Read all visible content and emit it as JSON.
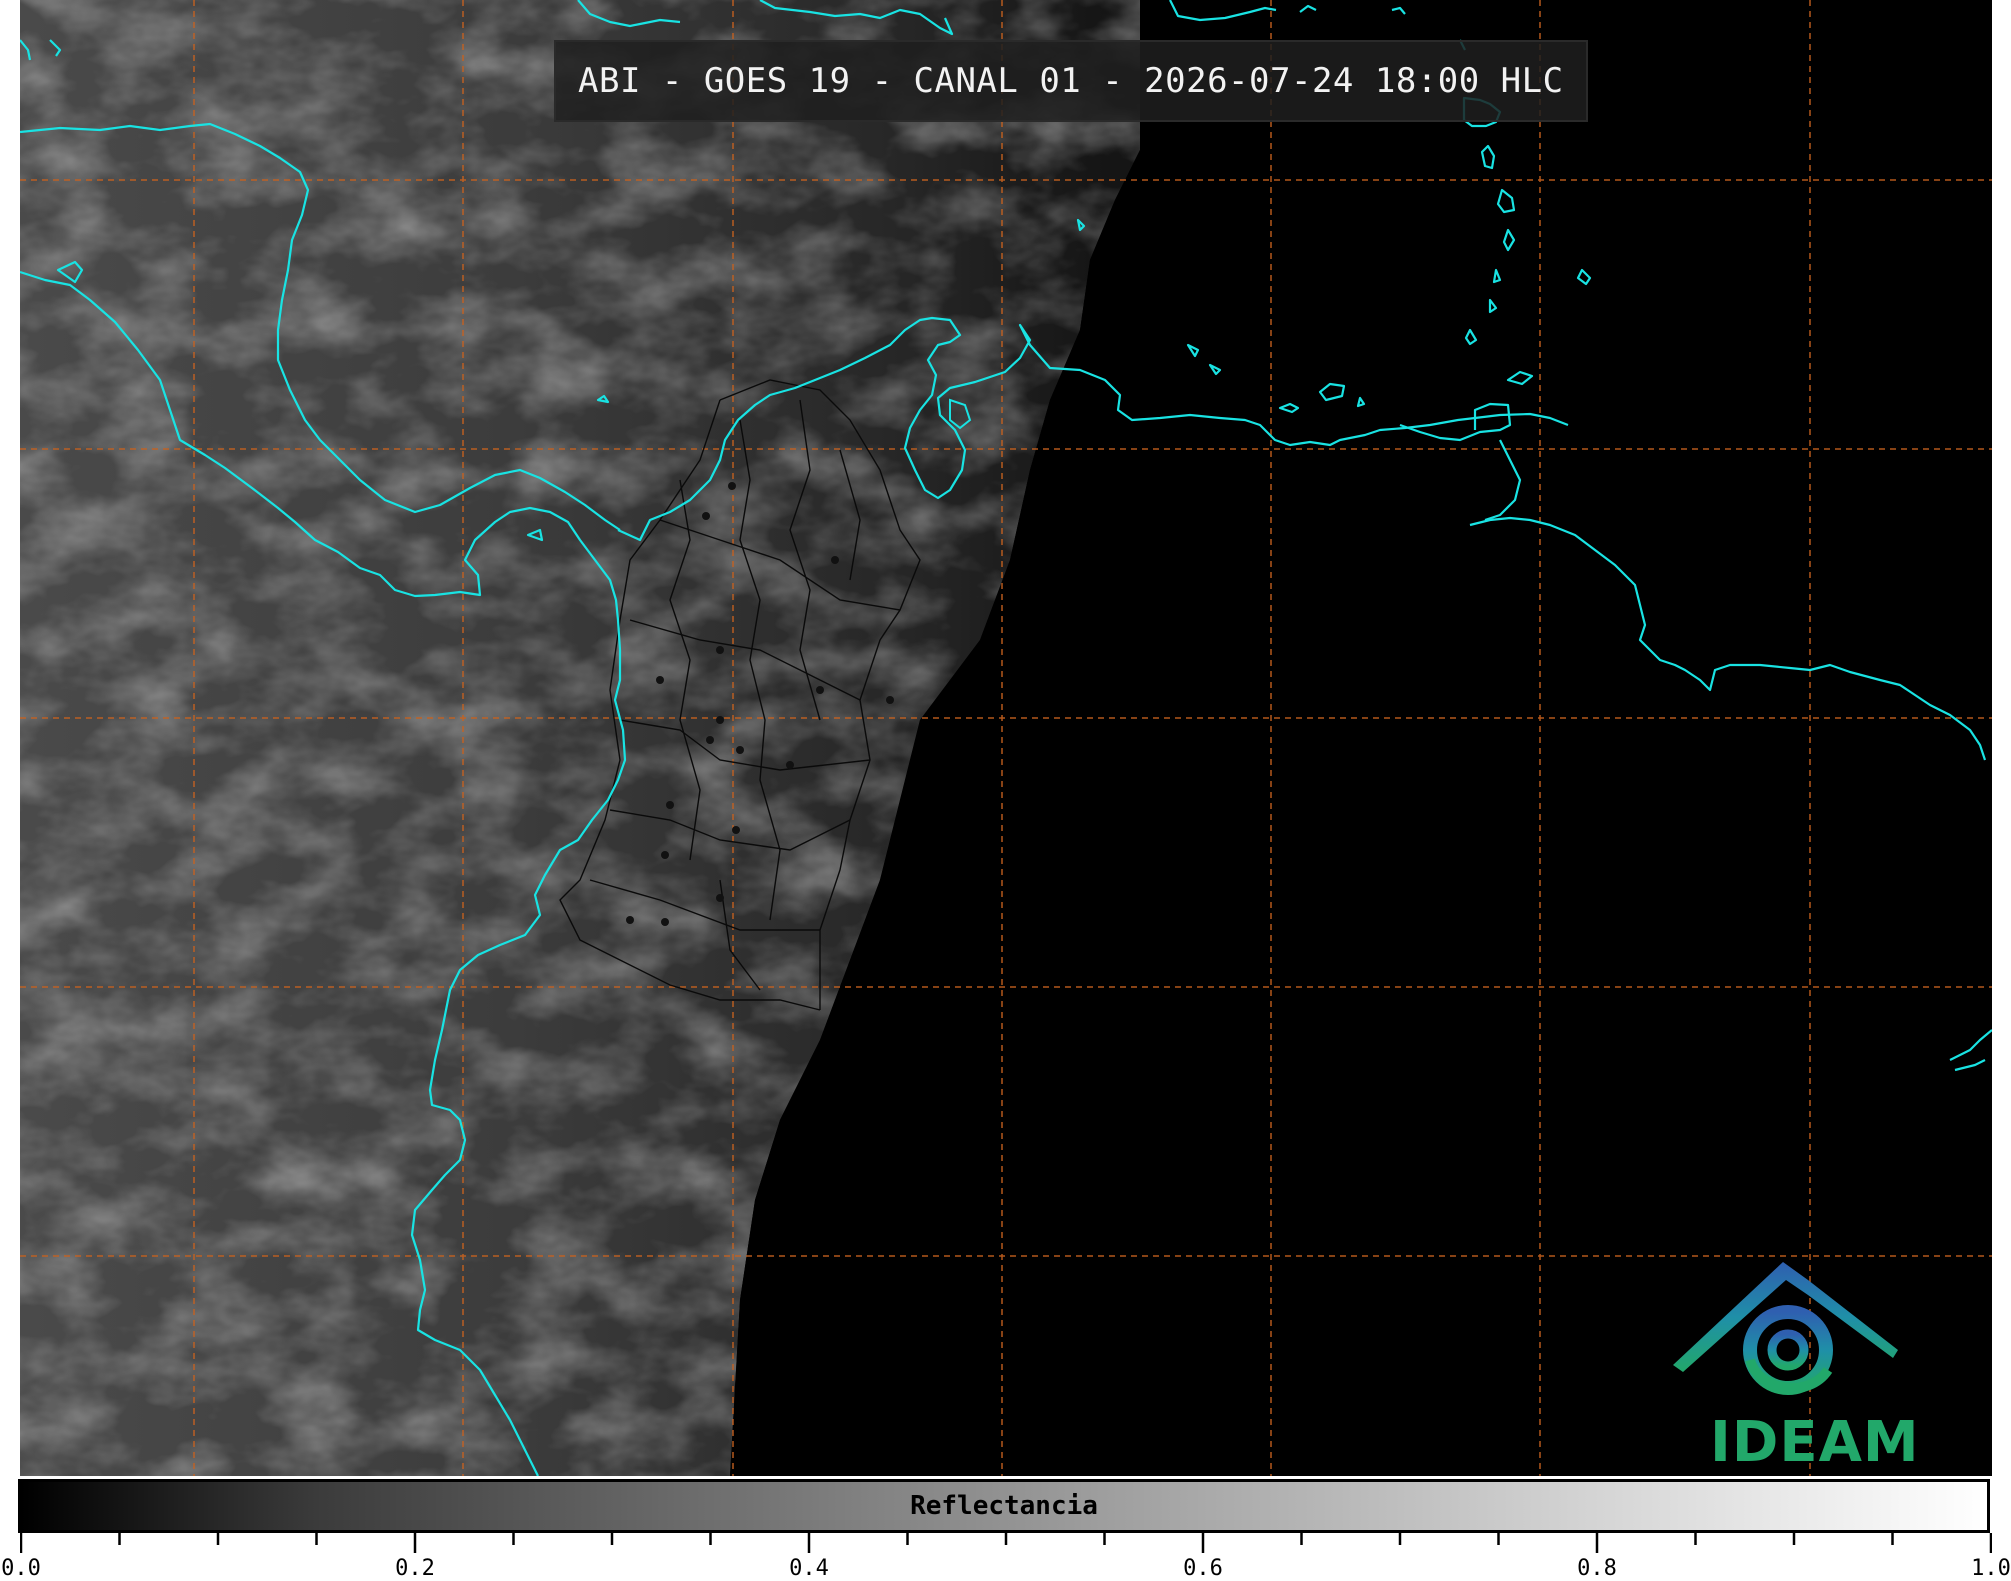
{
  "title": "ABI - GOES 19 - CANAL 01 - 2026-07-24 18:00 HLC",
  "logo": {
    "name": "ideam-logo-icon",
    "text": "IDEAM",
    "color": "#22a86a"
  },
  "colors": {
    "coastline": "#19e3e3",
    "gridlines": "#c8621f",
    "admin_borders": "#000000",
    "night_side": "#000000"
  },
  "colorbar": {
    "label": "Reflectancia",
    "range": [
      0.0,
      1.0
    ],
    "colormap": "grayscale",
    "tick_labels": [
      "0.0",
      "0.2",
      "0.4",
      "0.6",
      "0.8",
      "1.0"
    ],
    "tick_values": [
      0.0,
      0.2,
      0.4,
      0.6,
      0.8,
      1.0
    ],
    "minor_tick_step": 0.05
  }
}
